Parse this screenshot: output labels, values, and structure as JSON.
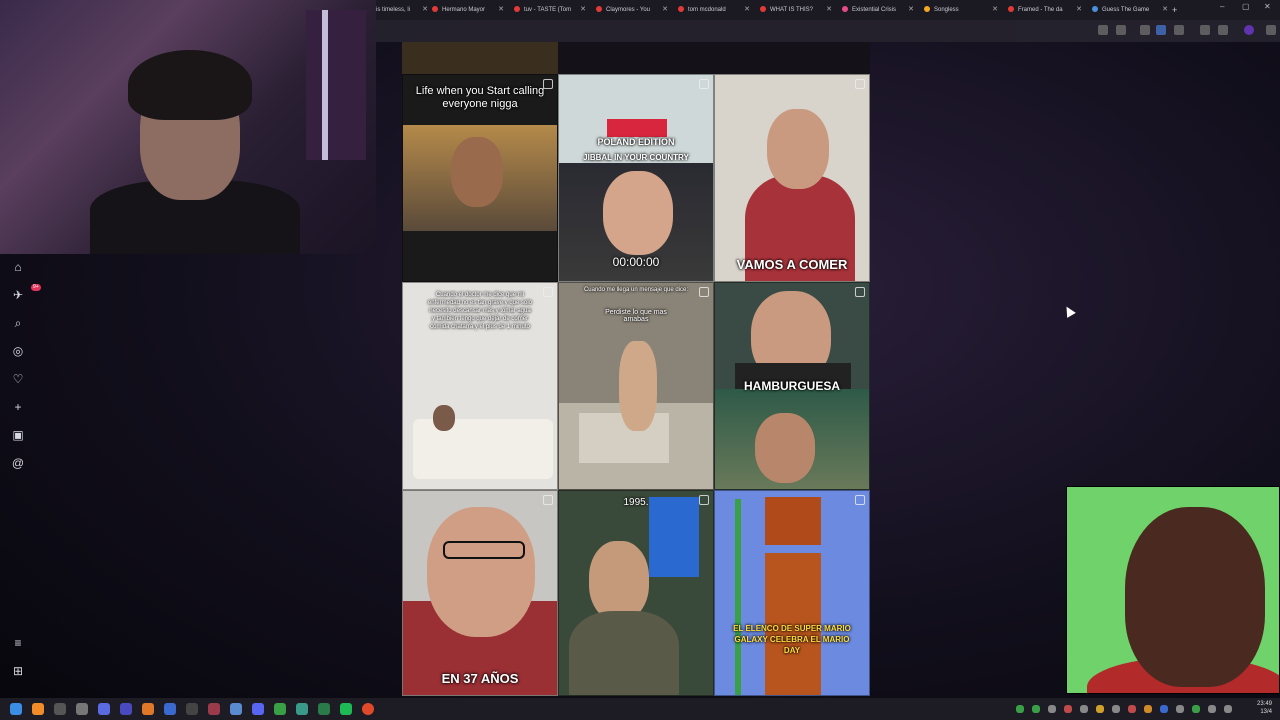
{
  "browser": {
    "tabs": [
      {
        "label": "is timeless, li",
        "color": "#e53935"
      },
      {
        "label": "Hermano Mayor",
        "color": "#e53935"
      },
      {
        "label": "tuv - TASTE (Tom",
        "color": "#e53935"
      },
      {
        "label": "Claymores - You",
        "color": "#e53935"
      },
      {
        "label": "tom mcdonald",
        "color": "#e53935"
      },
      {
        "label": "WHAT IS THIS?",
        "color": "#e53935"
      },
      {
        "label": "Existential Crisis",
        "color": "#e94b8a"
      },
      {
        "label": "Songless",
        "color": "#f5a623"
      },
      {
        "label": "Framed - The da",
        "color": "#e53935"
      },
      {
        "label": "Guess The Game",
        "color": "#4a90e2"
      }
    ],
    "new_tab": "+",
    "window_controls": [
      "–",
      "▢",
      "✕"
    ]
  },
  "sidebar": {
    "icons": [
      "home-icon",
      "inbox-icon",
      "search-icon",
      "explore-icon",
      "heart-icon",
      "create-icon",
      "profile-icon",
      "threads-icon",
      "menu-icon",
      "more-icon"
    ],
    "notification_count": "9+"
  },
  "feed": {
    "tiles": [
      {
        "caption": "Life when you Start calling everyone nigga"
      },
      {
        "caption": "POLAND EDITION",
        "subcaption": "JIBBAL IN YOUR COUNTRY",
        "timer": "00:00:00"
      },
      {
        "caption": "VAMOS A COMER"
      },
      {
        "caption": "Cuando el doctor me dice que mi enfermedad no es tan grave y que solo necesito descansar mas y tomar agua y tambien tengo que dejar de comer comida chatarra y el plus de 1 minuto"
      },
      {
        "caption": "Cuando me llega un mensaje que dice:",
        "subcaption": "Perdiste lo que mas amabas"
      },
      {
        "caption": "HAMBURGUESA"
      },
      {
        "caption": "EN 37 AÑOS"
      },
      {
        "caption": "1995."
      },
      {
        "caption": "EL ELENCO DE SUPER MARIO GALAXY CELEBRA EL MARIO DAY"
      }
    ]
  },
  "taskbar": {
    "clock_time": "23:49",
    "clock_date": "13/4"
  }
}
